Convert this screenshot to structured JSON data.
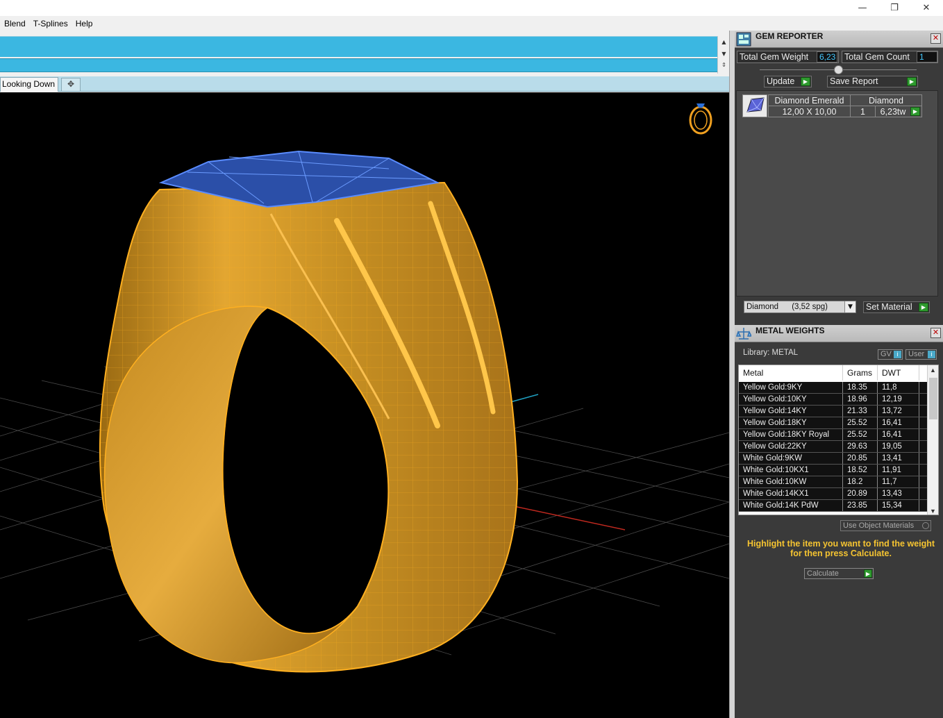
{
  "window": {
    "min_icon": "minimize-icon",
    "max_icon": "restore-icon",
    "close_icon": "close-icon"
  },
  "menu": [
    "Blend",
    "T-Splines",
    "Help"
  ],
  "tabs": {
    "active": "Looking Down",
    "add_glyph": "✥"
  },
  "gem_reporter": {
    "title": "GEM REPORTER",
    "total_gem_weight_label": "Total Gem Weight",
    "total_gem_weight_value": "6,23",
    "total_gem_count_label": "Total Gem Count",
    "total_gem_count_value": "1",
    "update_label": "Update",
    "save_report_label": "Save Report",
    "gem": {
      "shape": "Diamond Emerald",
      "material": "Diamond",
      "size": "12,00 X 10,00",
      "count": "1",
      "weight": "6,23tw"
    },
    "material_select": "Diamond      (3,52 spg)",
    "set_material_label": "Set Material"
  },
  "metal_weights": {
    "title": "METAL WEIGHTS",
    "library_label": "Library: METAL",
    "gv_label": "GV",
    "user_label": "User",
    "columns": [
      "Metal",
      "Grams",
      "DWT"
    ],
    "rows": [
      {
        "metal": "Yellow Gold:9KY",
        "grams": "18.35",
        "dwt": "11,8"
      },
      {
        "metal": "Yellow Gold:10KY",
        "grams": "18.96",
        "dwt": "12,19"
      },
      {
        "metal": "Yellow Gold:14KY",
        "grams": "21.33",
        "dwt": "13,72"
      },
      {
        "metal": "Yellow Gold:18KY",
        "grams": "25.52",
        "dwt": "16,41"
      },
      {
        "metal": "Yellow Gold:18KY Royal",
        "grams": "25.52",
        "dwt": "16,41"
      },
      {
        "metal": "Yellow Gold:22KY",
        "grams": "29.63",
        "dwt": "19,05"
      },
      {
        "metal": "White Gold:9KW",
        "grams": "20.85",
        "dwt": "13,41"
      },
      {
        "metal": "White Gold:10KX1",
        "grams": "18.52",
        "dwt": "11,91"
      },
      {
        "metal": "White Gold:10KW",
        "grams": "18.2",
        "dwt": "11,7"
      },
      {
        "metal": "White Gold:14KX1",
        "grams": "20.89",
        "dwt": "13,43"
      },
      {
        "metal": "White Gold:14K PdW",
        "grams": "23.85",
        "dwt": "15,34"
      }
    ],
    "use_object_materials_label": "Use Object Materials",
    "hint": "Highlight the item you want to find the weight for then press Calculate.",
    "calculate_label": "Calculate"
  },
  "colors": {
    "accent_blue": "#3bb7e1",
    "ring_gold": "#e9a21f",
    "gem_blue": "#3a63c9",
    "hint_yellow": "#f5c431",
    "go_green": "#2e9a2e"
  }
}
